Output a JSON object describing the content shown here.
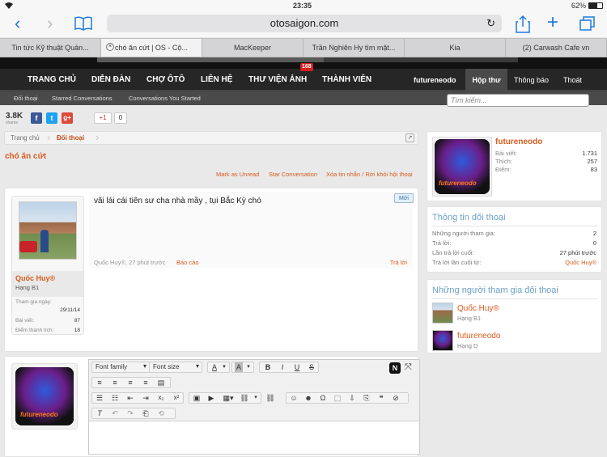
{
  "statusbar": {
    "time": "23:35",
    "battery": "62%"
  },
  "browser": {
    "url": "otosaigon.com"
  },
  "tabs": [
    {
      "label": "Tin tức Kỹ thuật Quản..."
    },
    {
      "label": "chó ăn cứt | OS - Cộ..."
    },
    {
      "label": "MacKeeper"
    },
    {
      "label": "Trần Nghiên Hy tìm mặt..."
    },
    {
      "label": "Kia"
    },
    {
      "label": "(2) Carwash Cafe vn"
    }
  ],
  "nav": {
    "items": [
      "TRANG CHỦ",
      "DIỄN ĐÀN",
      "CHỢ ÔTÔ",
      "LIÊN HỆ",
      "THƯ VIỆN ẢNH",
      "THÀNH VIÊN"
    ],
    "badge": "168",
    "user": "futureneodo",
    "inbox": "Hộp thư",
    "notifications": "Thông báo",
    "logout": "Thoát"
  },
  "subnav": [
    "Đối thoại",
    "Starred Conversations",
    "Conversations You Started"
  ],
  "search": {
    "placeholder": "Tìm kiếm..."
  },
  "share": {
    "count": "3.8K",
    "count_label": "shares",
    "gplus": "+1",
    "gplus_count": "0"
  },
  "breadcrumb": [
    "Trang chủ",
    "Đối thoại"
  ],
  "thread": {
    "title": "chó ăn cứt",
    "actions": [
      "Mark as Unread",
      "Star Conversation",
      "Xóa tin nhắn / Rời khỏi hội thoại"
    ]
  },
  "message": {
    "text": "vãi lái cái tiên sư cha nhà mầy , tụi Bắc Kỳ chó",
    "new_badge": "Mới",
    "meta": "Quốc Huy®, 27 phút trước",
    "report": "Báo cáo",
    "reply": "Trả lời",
    "author": {
      "name": "Quốc Huy®",
      "rank": "Hạng B1",
      "joined_label": "Tham gia ngày:",
      "joined": "29/11/14",
      "posts_label": "Bài viết:",
      "posts": "87",
      "points_label": "Điểm thành tích:",
      "points": "18"
    }
  },
  "profile": {
    "name": "futureneodo",
    "posts_label": "Bài viết:",
    "posts": "1.731",
    "likes_label": "Thích:",
    "likes": "257",
    "points_label": "Điểm:",
    "points": "83"
  },
  "convo_info": {
    "title": "Thông tin đối thoại",
    "participants_label": "Những người tham gia:",
    "participants": "2",
    "replies_label": "Trả lời:",
    "replies": "0",
    "last_reply_label": "Lần trả lời cuối:",
    "last_reply": "27 phút trước",
    "last_replier_label": "Trả lời lần cuối từ:",
    "last_replier": "Quốc Huy®"
  },
  "participants": {
    "title": "Những người tham gia đối thoại",
    "list": [
      {
        "name": "Quốc Huy®",
        "rank": "Hạng B1"
      },
      {
        "name": "futureneodo",
        "rank": "Hạng D"
      }
    ]
  },
  "editor": {
    "font_family": "Font family",
    "font_size": "Font size"
  },
  "logo_text": "futureneodo",
  "colors": {
    "accent": "#d95b1f",
    "nav": "#262626",
    "link_blue": "#6ba1c8"
  }
}
